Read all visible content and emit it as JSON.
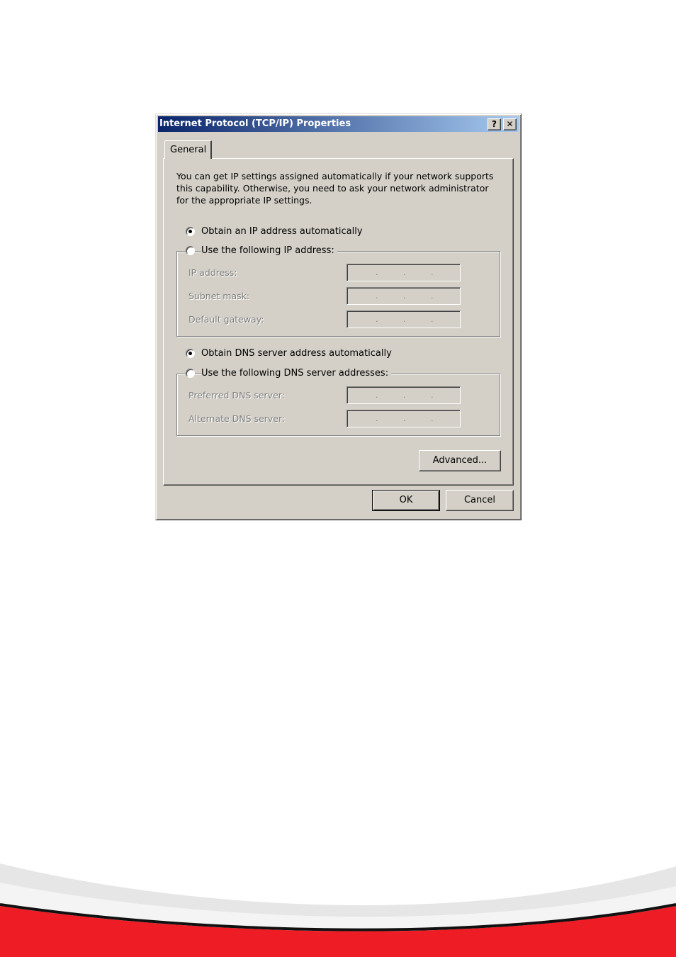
{
  "dialog": {
    "title": "Internet Protocol (TCP/IP) Properties",
    "help_button": "?",
    "close_button": "✕"
  },
  "tabs": [
    {
      "label": "General",
      "selected": true
    }
  ],
  "general": {
    "info_text": "You can get IP settings assigned automatically if your network supports this capability. Otherwise, you need to ask your network administrator for the appropriate IP settings.",
    "ip_auto": {
      "label": "Obtain an IP address automatically",
      "checked": true
    },
    "ip_manual": {
      "label": "Use the following IP address:",
      "checked": false,
      "fields": [
        {
          "label": "IP address:",
          "value": ""
        },
        {
          "label": "Subnet mask:",
          "value": ""
        },
        {
          "label": "Default gateway:",
          "value": ""
        }
      ]
    },
    "dns_auto": {
      "label": "Obtain DNS server address automatically",
      "checked": true
    },
    "dns_manual": {
      "label": "Use the following DNS server addresses:",
      "checked": false,
      "fields": [
        {
          "label": "Preferred DNS server:",
          "value": ""
        },
        {
          "label": "Alternate DNS server:",
          "value": ""
        }
      ]
    },
    "advanced_label": "Advanced..."
  },
  "buttons": {
    "ok_label": "OK",
    "cancel_label": "Cancel"
  },
  "colors": {
    "titlebar_start": "#0a246a",
    "titlebar_end": "#a6caf0",
    "dialog_face": "#d4d0c8",
    "footer_red": "#ee1c24"
  }
}
